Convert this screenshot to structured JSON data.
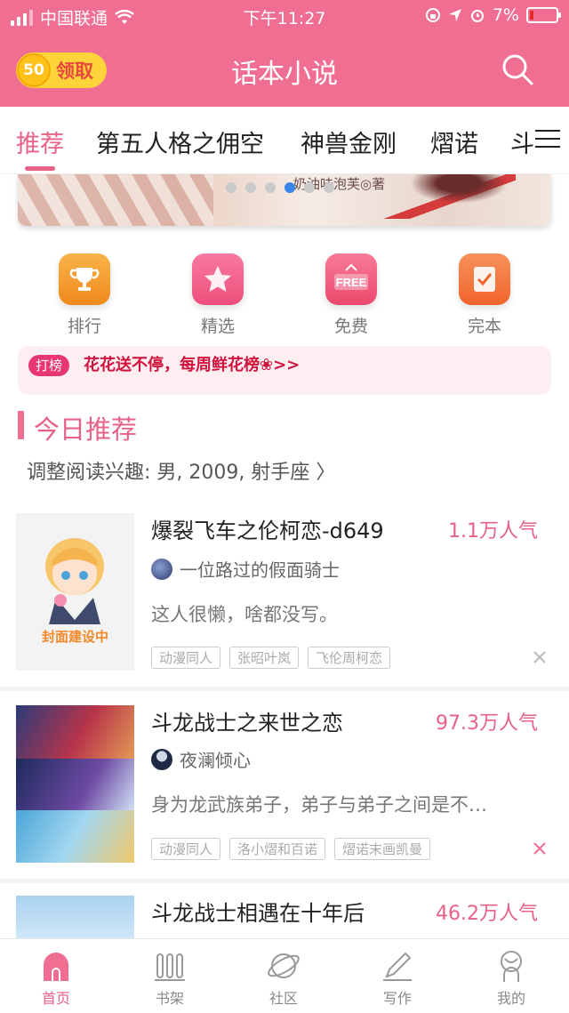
{
  "status_bar": {
    "carrier": "中国联通",
    "time": "下午11:27",
    "battery": "7%"
  },
  "header": {
    "reward_count": "50",
    "reward_label": "领取",
    "title": "话本小说"
  },
  "tabs": [
    {
      "label": "推荐"
    },
    {
      "label": "第五人格之佣空"
    },
    {
      "label": "神兽金刚"
    },
    {
      "label": "熠诺"
    },
    {
      "label": "斗"
    }
  ],
  "banner": {
    "author_text": "奶油味泡芙◎著"
  },
  "quick_menu": [
    {
      "label": "排行",
      "icon": "trophy-icon",
      "color": "#f39a2e"
    },
    {
      "label": "精选",
      "icon": "star-icon",
      "color": "#f2618a"
    },
    {
      "label": "免费",
      "icon": "free-icon",
      "color": "#f0607f"
    },
    {
      "label": "完本",
      "icon": "check-book-icon",
      "color": "#f37a3c"
    }
  ],
  "promo": {
    "badge": "打榜",
    "message": "花花送不停，每周鲜花榜❀>>"
  },
  "section": {
    "title": "今日推荐",
    "interest": "调整阅读兴趣: 男, 2009, 射手座 〉"
  },
  "books": [
    {
      "title": "爆裂飞车之伦柯恋-d649",
      "popularity": "1.1万人气",
      "author": "一位路过的假面骑士",
      "description": "这人很懒，啥都没写。",
      "tags": [
        "动漫同人",
        "张昭叶岚",
        "飞伦周柯恋"
      ],
      "cover_text": "封面建设中"
    },
    {
      "title": "斗龙战士之来世之恋",
      "popularity": "97.3万人气",
      "author": "夜澜倾心",
      "description": "身为龙武族弟子，弟子与弟子之间是不…",
      "tags": [
        "动漫同人",
        "洛小熠和百诺",
        "熠诺末画凯曼"
      ]
    },
    {
      "title": "斗龙战士相遇在十年后",
      "popularity": "46.2万人气"
    }
  ],
  "bottom_nav": [
    {
      "label": "首页",
      "icon": "home-icon"
    },
    {
      "label": "书架",
      "icon": "bookshelf-icon"
    },
    {
      "label": "社区",
      "icon": "planet-icon"
    },
    {
      "label": "写作",
      "icon": "pen-icon"
    },
    {
      "label": "我的",
      "icon": "profile-icon"
    }
  ],
  "colors": {
    "brand": "#f06e92",
    "accent": "#e86187",
    "promo_text": "#d0123c"
  }
}
